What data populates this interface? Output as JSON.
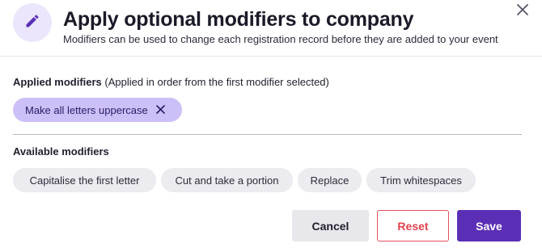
{
  "dialog": {
    "title": "Apply optional modifiers to company",
    "subtitle": "Modifiers can be used to change each registration record before they are added to your event",
    "header_icon": "pencil-icon",
    "close_icon": "close-icon"
  },
  "applied": {
    "label_bold": "Applied modifiers",
    "label_note": "(Applied in order from the first modifier selected)",
    "chips": [
      {
        "label": "Make all letters uppercase",
        "remove_icon": "close-icon"
      }
    ]
  },
  "available": {
    "label": "Available modifiers",
    "chips": [
      {
        "label": "Capitalise the first letter"
      },
      {
        "label": "Cut and take a portion"
      },
      {
        "label": "Replace"
      },
      {
        "label": "Trim whitespaces"
      }
    ]
  },
  "actions": {
    "cancel_label": "Cancel",
    "reset_label": "Reset",
    "save_label": "Save"
  },
  "colors": {
    "accent": "#5b2fb5",
    "applied_chip": "#cdbff7",
    "available_chip": "#ebebf0",
    "danger": "#e0424f"
  }
}
